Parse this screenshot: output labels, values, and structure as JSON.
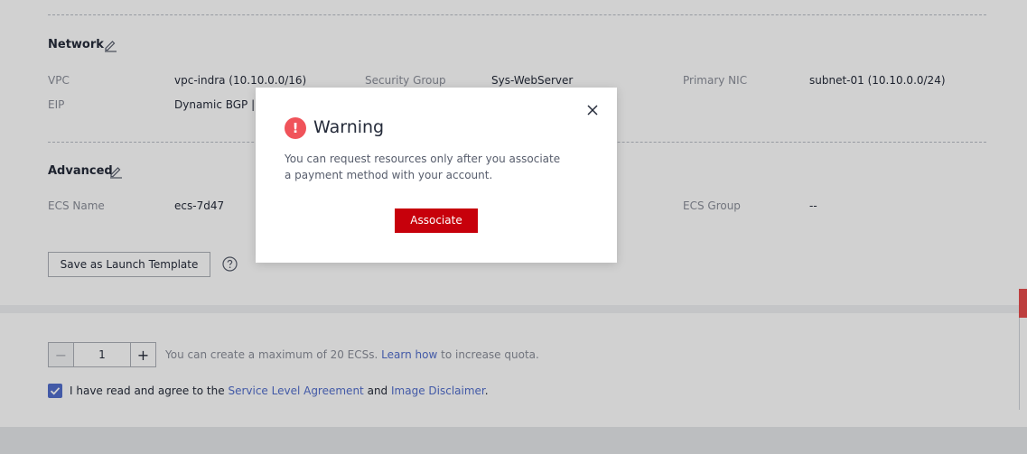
{
  "network": {
    "title": "Network",
    "vpc_label": "VPC",
    "vpc_value": "vpc-indra (10.10.0.0/16)",
    "security_group_label": "Security Group",
    "security_group_value": "Sys-WebServer",
    "primary_nic_label": "Primary NIC",
    "primary_nic_value": "subnet-01 (10.10.0.0/24)",
    "eip_label": "EIP",
    "eip_value": "Dynamic BGP |"
  },
  "advanced": {
    "title": "Advanced",
    "ecs_name_label": "ECS Name",
    "ecs_name_value": "ecs-7d47",
    "ecs_group_label": "ECS Group",
    "ecs_group_value": "--"
  },
  "actions": {
    "save_template_label": "Save as Launch Template",
    "help_icon": "question-circle-icon"
  },
  "quantity": {
    "value": "1",
    "minus_symbol": "−",
    "plus_symbol": "+",
    "note_prefix": "You can create a maximum of 20 ECSs.",
    "note_link": "Learn how",
    "note_suffix": "to increase quota."
  },
  "agreement": {
    "checked": true,
    "prefix": "I have read and agree to the",
    "sla_link": "Service Level Agreement",
    "and_text": "and",
    "disclaimer_link": "Image Disclaimer",
    "suffix": "."
  },
  "modal": {
    "title": "Warning",
    "icon_glyph": "!",
    "message": "You can request resources only after you associate a payment method with your account.",
    "associate_label": "Associate",
    "close_icon": "close-icon"
  },
  "colors": {
    "primary_button": "#c7000b",
    "link": "#526ecc",
    "warning_icon": "#f0535a",
    "checkbox": "#526ecc"
  }
}
